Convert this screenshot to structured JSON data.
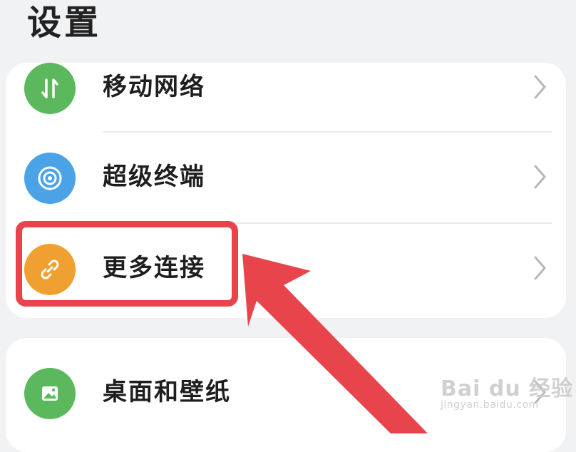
{
  "header": {
    "title": "设置"
  },
  "settings": {
    "items": [
      {
        "label": "移动网络",
        "icon": "mobile-network-icon",
        "color": "#5cb85c"
      },
      {
        "label": "超级终端",
        "icon": "super-device-icon",
        "color": "#4aa3e6"
      },
      {
        "label": "更多连接",
        "icon": "link-icon",
        "color": "#f0a030"
      },
      {
        "label": "桌面和壁纸",
        "icon": "wallpaper-icon",
        "color": "#5cb85c"
      }
    ]
  },
  "annotation": {
    "highlight_color": "#e8444c",
    "target": "更多连接"
  },
  "watermark": {
    "brand": "Bai du 经验",
    "url": "jingyan.baidu.com"
  }
}
